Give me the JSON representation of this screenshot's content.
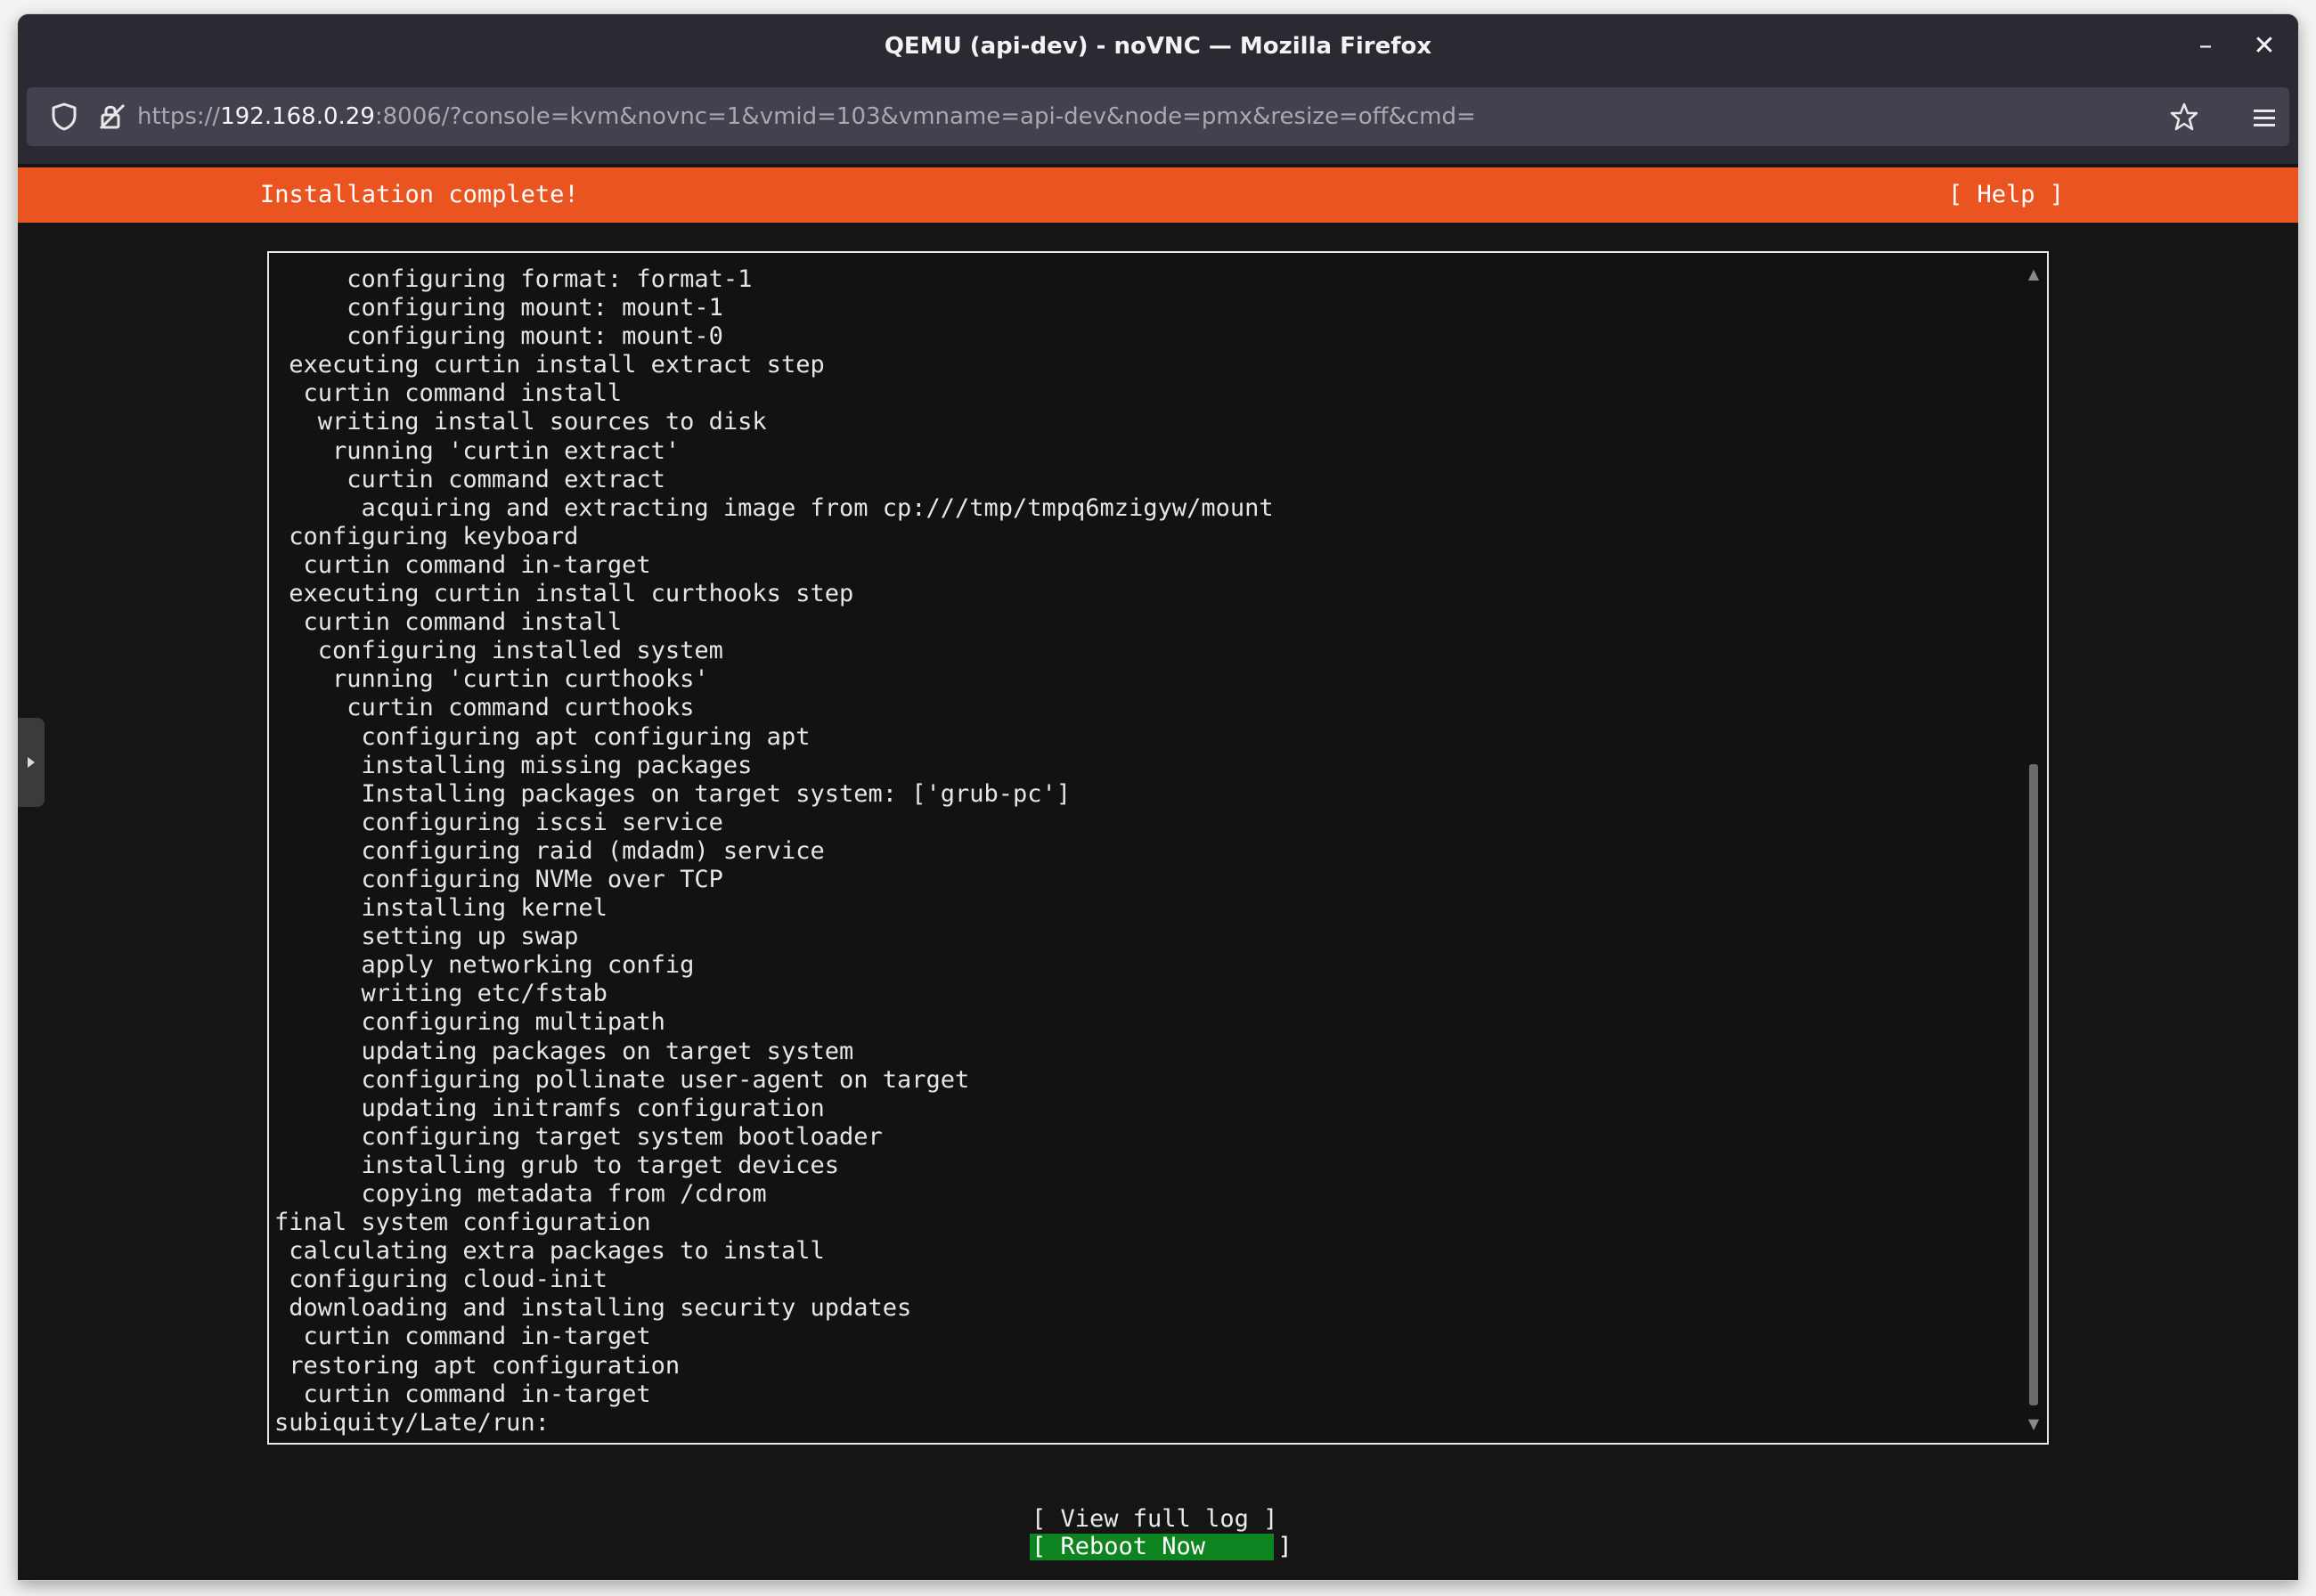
{
  "window": {
    "title": "QEMU (api-dev) - noVNC — Mozilla Firefox"
  },
  "browser": {
    "url_prefix": "https://",
    "url_host": "192.168.0.29",
    "url_rest": ":8006/?console=kvm&novnc=1&vmid=103&vmname=api-dev&node=pmx&resize=off&cmd="
  },
  "installer": {
    "status_title": "Installation complete!",
    "help_label": "[ Help ]",
    "log_lines": [
      "     configuring format: format-1",
      "     configuring mount: mount-1",
      "     configuring mount: mount-0",
      " executing curtin install extract step",
      "  curtin command install",
      "   writing install sources to disk",
      "    running 'curtin extract'",
      "     curtin command extract",
      "      acquiring and extracting image from cp:///tmp/tmpq6mzigyw/mount",
      " configuring keyboard",
      "  curtin command in-target",
      " executing curtin install curthooks step",
      "  curtin command install",
      "   configuring installed system",
      "    running 'curtin curthooks'",
      "     curtin command curthooks",
      "      configuring apt configuring apt",
      "      installing missing packages",
      "      Installing packages on target system: ['grub-pc']",
      "      configuring iscsi service",
      "      configuring raid (mdadm) service",
      "      configuring NVMe over TCP",
      "      installing kernel",
      "      setting up swap",
      "      apply networking config",
      "      writing etc/fstab",
      "      configuring multipath",
      "      updating packages on target system",
      "      configuring pollinate user-agent on target",
      "      updating initramfs configuration",
      "      configuring target system bootloader",
      "      installing grub to target devices",
      "      copying metadata from /cdrom",
      "final system configuration",
      " calculating extra packages to install",
      " configuring cloud-init",
      " downloading and installing security updates",
      "  curtin command in-target",
      " restoring apt configuration",
      "  curtin command in-target",
      "subiquity/Late/run:"
    ],
    "view_log_label": "[ View full log ]",
    "reboot_label": "[ Reboot Now     ]"
  },
  "icons": {
    "shield": "shield-icon",
    "lock": "lock-warning-icon",
    "star": "star-icon",
    "menu": "hamburger-menu-icon",
    "minimize": "minimize-icon",
    "close": "close-icon"
  },
  "colors": {
    "accent": "#e95420",
    "selected_button": "#0e8420",
    "terminal_bg": "#121212"
  }
}
